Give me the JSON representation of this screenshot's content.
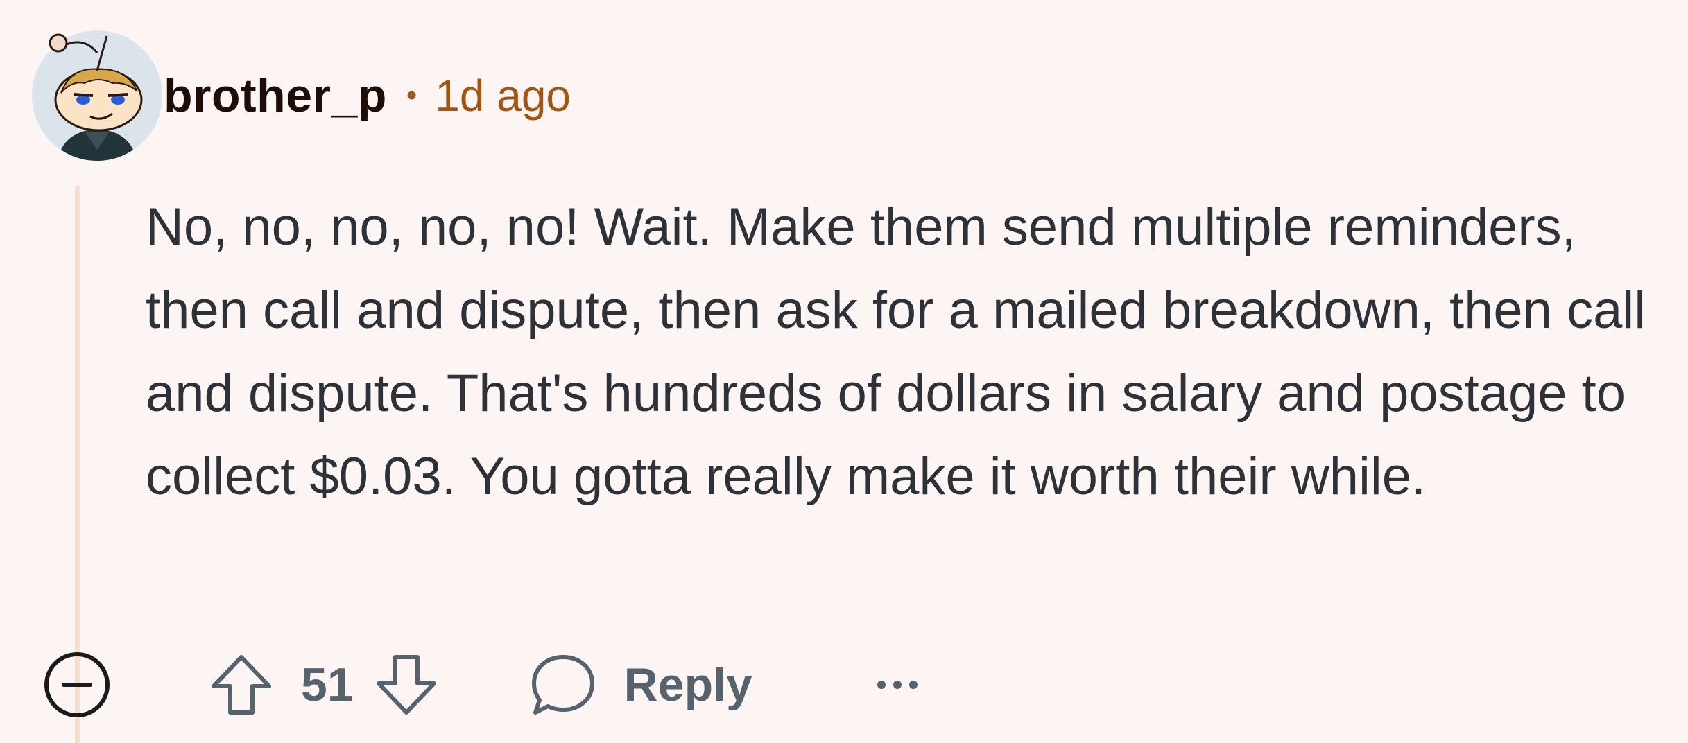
{
  "comment": {
    "username": "brother_p",
    "separator": "•",
    "timestamp": "1d ago",
    "body": "No, no, no, no, no! Wait. Make them send multiple reminders, then call and dispute, then ask for a mailed breakdown, then call and dispute. That's hundreds of dollars in salary and postage to collect $0.03. You gotta really make it worth their while.",
    "score": "51",
    "reply_label": "Reply"
  },
  "icons": {
    "collapse": "collapse-thread-icon",
    "upvote": "upvote-arrow-icon",
    "downvote": "downvote-arrow-icon",
    "reply": "speech-bubble-icon",
    "more": "more-options-icon"
  },
  "colors": {
    "background": "#fcf5f3",
    "username": "#1c0d06",
    "timestamp": "#a3540f",
    "body_text": "#2c3238",
    "action_text": "#56636c",
    "thread_line": "#f7dfcb"
  }
}
